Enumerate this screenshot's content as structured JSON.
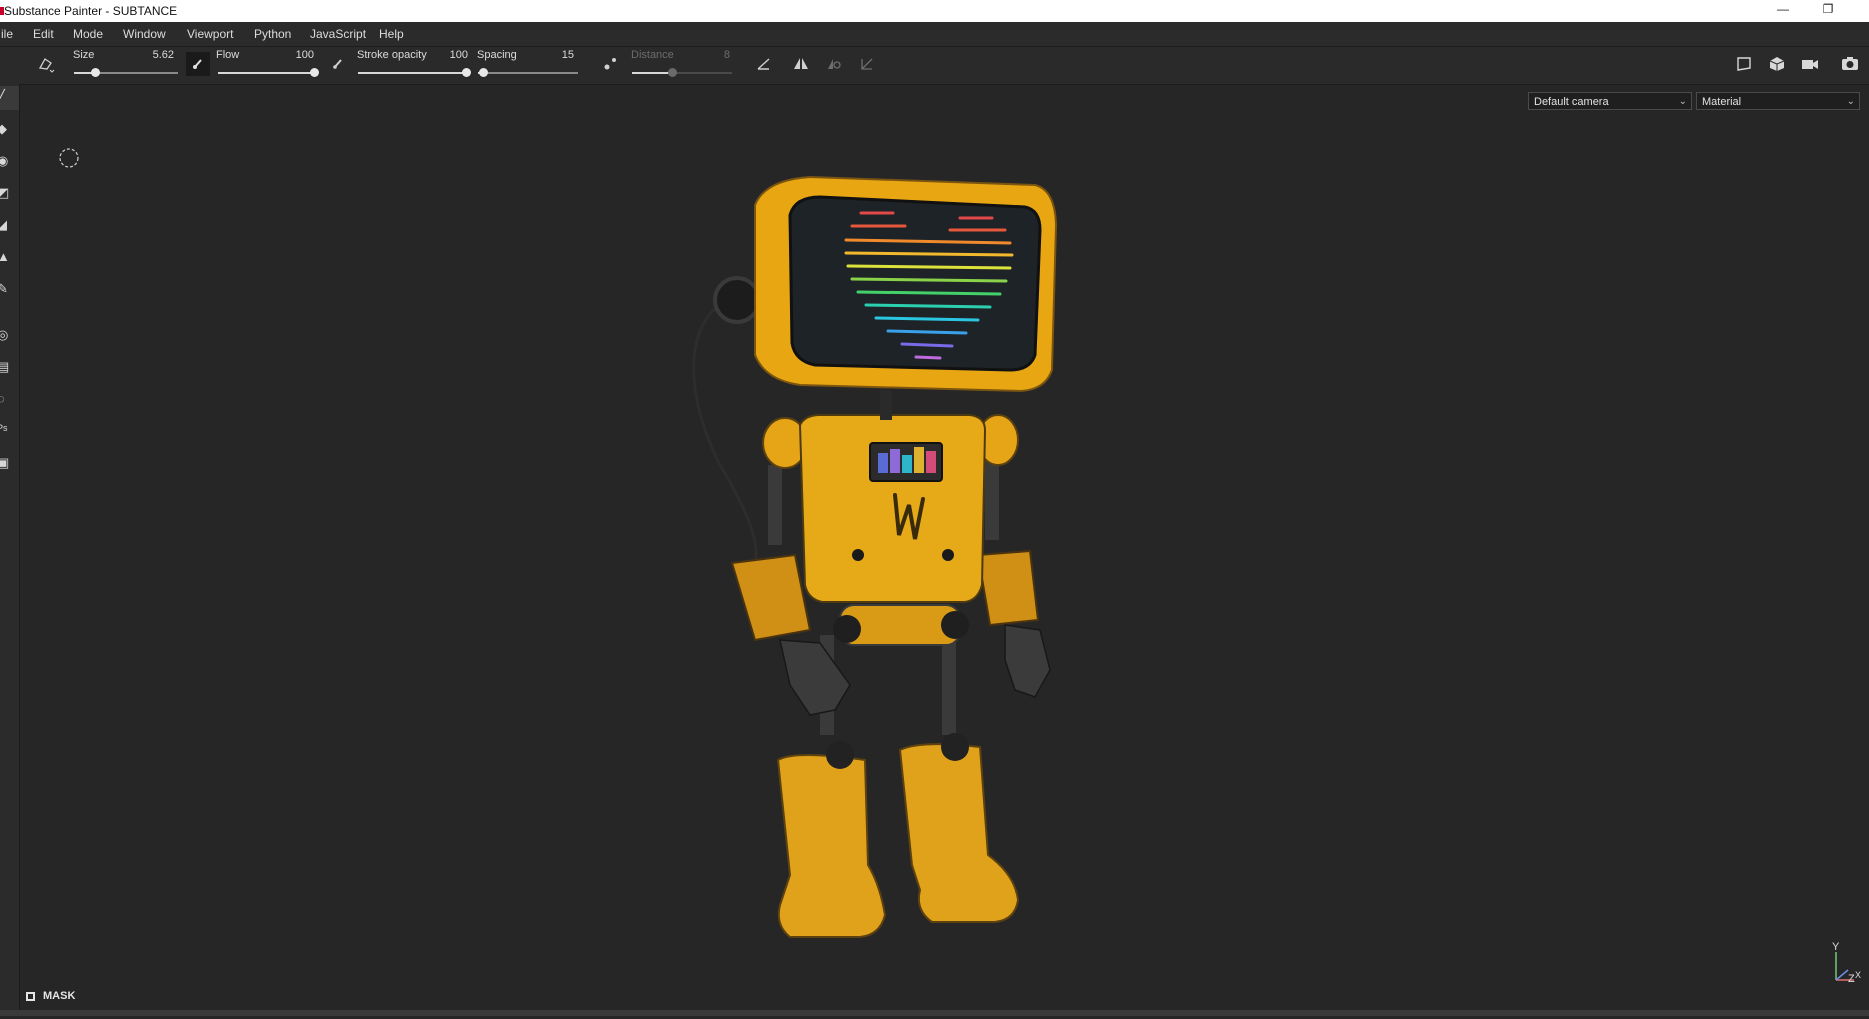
{
  "window": {
    "title": "Substance Painter - SUBTANCE",
    "minimize_glyph": "—",
    "restore_glyph": "❐"
  },
  "menu": [
    "ile",
    "Edit",
    "Mode",
    "Window",
    "Viewport",
    "Python",
    "JavaScript",
    "Help"
  ],
  "toolbar": {
    "size": {
      "label": "Size",
      "value": "5.62",
      "fraction": 0.2
    },
    "flow": {
      "label": "Flow",
      "value": "100",
      "fraction": 1.0
    },
    "stroke_opacity": {
      "label": "Stroke opacity",
      "value": "100",
      "fraction": 1.0
    },
    "spacing": {
      "label": "Spacing",
      "value": "15",
      "fraction": 0.05
    },
    "distance": {
      "label": "Distance",
      "value": "8",
      "fraction": 0.4,
      "enabled": false
    }
  },
  "left_tools": [
    {
      "name": "paint-brush-icon",
      "glyph": "╱",
      "active": true
    },
    {
      "name": "eraser-icon",
      "glyph": "◆"
    },
    {
      "name": "projection-icon",
      "glyph": "◉"
    },
    {
      "name": "geometry-mask-icon",
      "glyph": "◩"
    },
    {
      "name": "smudge-icon",
      "glyph": "◢"
    },
    {
      "name": "clone-stamp-icon",
      "glyph": "▲"
    },
    {
      "name": "color-picker-icon",
      "glyph": "✎"
    },
    {
      "name": "bake-icon",
      "glyph": "◎"
    },
    {
      "name": "polygon-fill-icon",
      "glyph": "▤"
    },
    {
      "name": "symmetry-icon",
      "glyph": "◌"
    },
    {
      "name": "photoshop-export-icon",
      "glyph": "Ps"
    },
    {
      "name": "render-icon",
      "glyph": "▣"
    }
  ],
  "viewport": {
    "camera_select": "Default camera",
    "channel_select": "Material",
    "mask_label": "MASK",
    "axis_labels": {
      "y": "Y",
      "z": "Z",
      "x": "X"
    }
  },
  "colors": {
    "background": "#262626",
    "robot_yellow": "#e8a712",
    "screen": "#1d2326"
  },
  "icons": {
    "brush_icon": "paint-brush-icon",
    "distance_icon": "lazy-mouse-icon",
    "angle_icon": "angle-icon",
    "symmetry_icon": "symmetry-icon",
    "display_icons": [
      "2d-view-icon",
      "3d-cube-icon",
      "camera-icon",
      "screenshot-icon"
    ]
  }
}
